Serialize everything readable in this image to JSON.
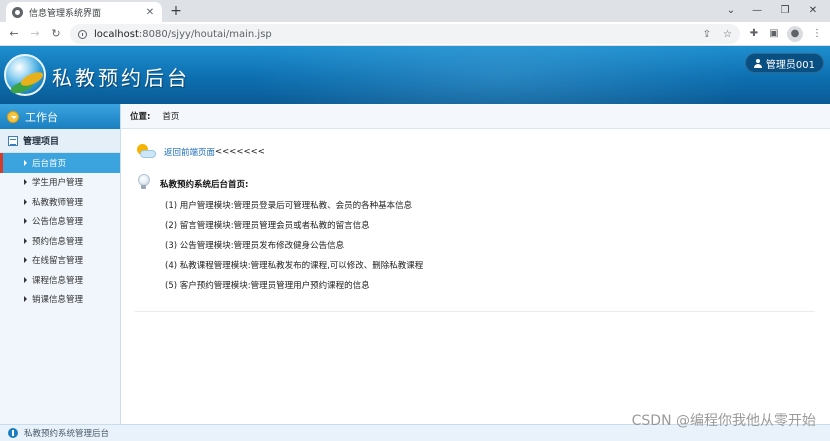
{
  "browser": {
    "tab_title": "信息管理系统界面",
    "url_host": "localhost",
    "url_path": ":8080/sjyy/houtai/main.jsp"
  },
  "header": {
    "title": "私教预约后台",
    "user_label": "管理员001"
  },
  "sidebar": {
    "workbench_label": "工作台",
    "section_label": "管理项目",
    "items": [
      {
        "label": "后台首页",
        "active": true
      },
      {
        "label": "学生用户管理"
      },
      {
        "label": "私教教师管理"
      },
      {
        "label": "公告信息管理"
      },
      {
        "label": "预约信息管理"
      },
      {
        "label": "在线留言管理"
      },
      {
        "label": "课程信息管理"
      },
      {
        "label": "销课信息管理"
      }
    ]
  },
  "main": {
    "breadcrumb_label": "位置:",
    "breadcrumb_value": "首页",
    "back_link": "返回前端页面",
    "back_arrows": "<<<<<<<",
    "intro_title": "私教预约系统后台首页:",
    "intro_items": [
      "(1) 用户管理模块:管理员登录后可管理私教、会员的各种基本信息",
      "(2) 留言管理模块:管理员管理会员或者私教的留言信息",
      "(3) 公告管理模块:管理员发布修改健身公告信息",
      "(4) 私教课程管理模块:管理私教发布的课程,可以修改、删除私教课程",
      "(5) 客户预约管理模块:管理员管理用户预约课程的信息"
    ]
  },
  "status_bar": {
    "text": "私教预约系统管理后台"
  },
  "watermark": "CSDN @编程你我他从零开始",
  "colors": {
    "header_blue": "#0d6fb0",
    "active_menu": "#3ba3dd",
    "active_marker": "#d33b2b",
    "link": "#1c6db7"
  }
}
